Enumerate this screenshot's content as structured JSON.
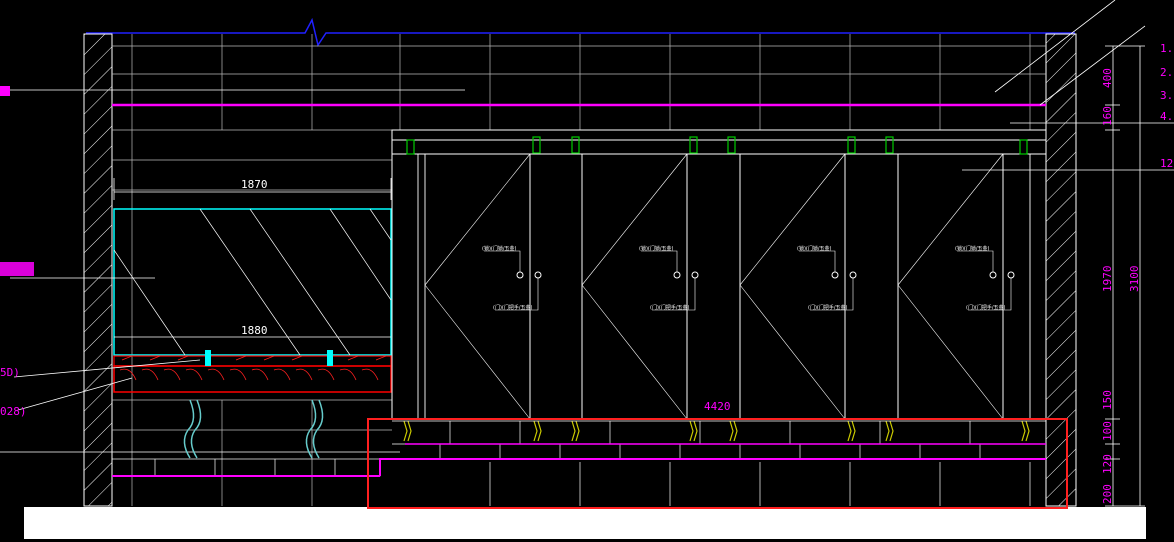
{
  "colors": {
    "background": "#000000",
    "line": "#ffffff",
    "accent_magenta": "#ff00ff",
    "accent_red": "#ff0000",
    "accent_cyan": "#00ffff",
    "accent_blue": "#0000ff",
    "accent_green": "#00cc00",
    "floor": "#ffffff"
  },
  "dimensions": {
    "mirror_width_top": "1870",
    "mirror_width_bottom": "1880",
    "partition_width": "4420",
    "right_segments": [
      "400",
      "160",
      "1970",
      "150",
      "100",
      "120",
      "200"
    ],
    "total_height": "3100"
  },
  "callouts": {
    "right_numbers": [
      "1.",
      "2.",
      "3.",
      "4.",
      "12"
    ],
    "left_fragments": [
      "5D)",
      "028)"
    ]
  },
  "door_labels": {
    "lock_top": "(锁)(门锁/五金)",
    "lock_bottom": "(门)(门把手/五金)"
  },
  "stalls": [
    "stall-1",
    "stall-2",
    "stall-3",
    "stall-4"
  ]
}
